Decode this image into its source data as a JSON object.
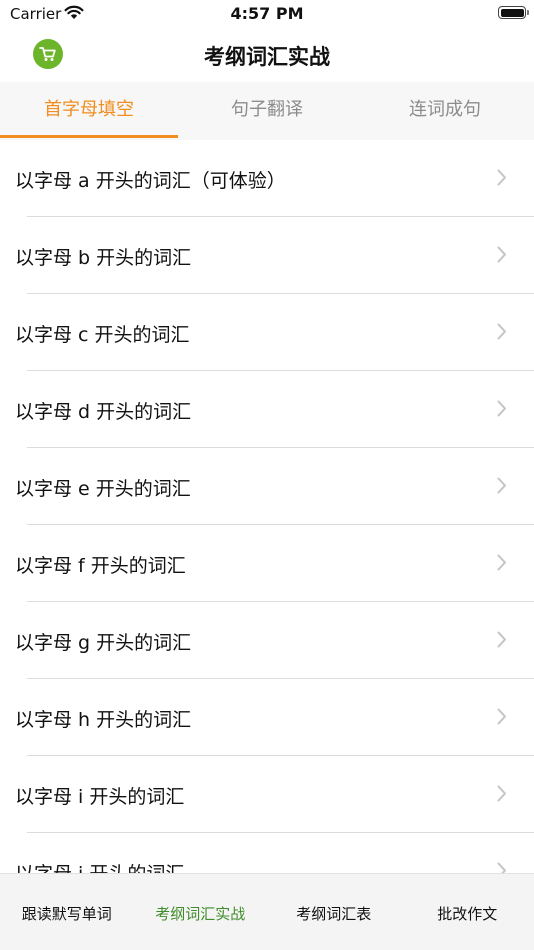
{
  "status_bar": {
    "carrier": "Carrier",
    "time": "4:57 PM"
  },
  "nav": {
    "title": "考纲词汇实战",
    "cart_icon": "shopping-cart-icon",
    "cart_color": "#6cb42a"
  },
  "tabs": [
    {
      "label": "首字母填空",
      "active": true
    },
    {
      "label": "句子翻译",
      "active": false
    },
    {
      "label": "连词成句",
      "active": false
    }
  ],
  "list": {
    "items": [
      {
        "label": "以字母 a 开头的词汇（可体验）"
      },
      {
        "label": "以字母 b 开头的词汇"
      },
      {
        "label": "以字母 c 开头的词汇"
      },
      {
        "label": "以字母 d 开头的词汇"
      },
      {
        "label": "以字母 e 开头的词汇"
      },
      {
        "label": "以字母 f 开头的词汇"
      },
      {
        "label": "以字母 g 开头的词汇"
      },
      {
        "label": "以字母 h 开头的词汇"
      },
      {
        "label": "以字母 i 开头的词汇"
      },
      {
        "label": "以字母 j 开头的词汇"
      }
    ],
    "chevron_icon": "chevron-right-icon"
  },
  "tabbar": {
    "items": [
      {
        "label": "跟读默写单词",
        "active": false
      },
      {
        "label": "考纲词汇实战",
        "active": true
      },
      {
        "label": "考纲词汇表",
        "active": false
      },
      {
        "label": "批改作文",
        "active": false
      }
    ]
  },
  "colors": {
    "accent_orange": "#f28d1f",
    "active_green": "#3f8c2a",
    "inactive_tab": "#8c8c8c"
  }
}
